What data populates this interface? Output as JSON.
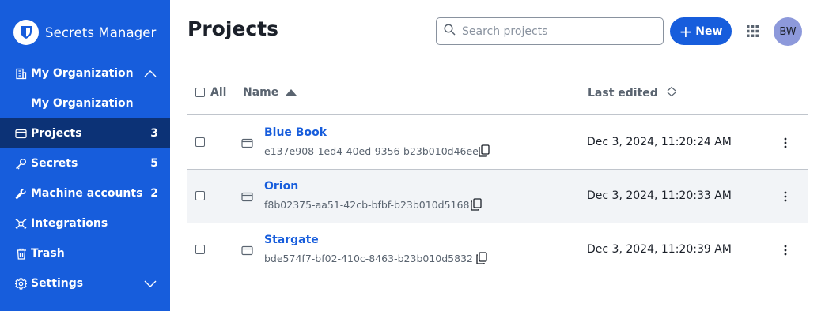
{
  "sidebar": {
    "brand": "Secrets Manager",
    "items": [
      {
        "label": "My Organization",
        "count": ""
      },
      {
        "label": "My Organization",
        "count": ""
      },
      {
        "label": "Projects",
        "count": "3"
      },
      {
        "label": "Secrets",
        "count": "5"
      },
      {
        "label": "Machine accounts",
        "count": "2"
      },
      {
        "label": "Integrations",
        "count": ""
      },
      {
        "label": "Trash",
        "count": ""
      },
      {
        "label": "Settings",
        "count": ""
      }
    ]
  },
  "header": {
    "title": "Projects",
    "search_placeholder": "Search projects",
    "new_label": "New",
    "avatar_initials": "BW"
  },
  "table": {
    "col_all": "All",
    "col_name": "Name",
    "col_edited": "Last edited",
    "rows": [
      {
        "name": "Blue Book",
        "id": "e137e908-1ed4-40ed-9356-b23b010d46ee",
        "edited": "Dec 3, 2024, 11:20:24 AM"
      },
      {
        "name": "Orion",
        "id": "f8b02375-aa51-42cb-bfbf-b23b010d5168",
        "edited": "Dec 3, 2024, 11:20:33 AM"
      },
      {
        "name": "Stargate",
        "id": "bde574f7-bf02-410c-8463-b23b010d5832",
        "edited": "Dec 3, 2024, 11:20:39 AM"
      }
    ]
  },
  "colors": {
    "sidebar_bg": "#175ddc",
    "sidebar_active": "#0c3276",
    "accent": "#175ddc",
    "row_alt": "#f2f4f7"
  }
}
